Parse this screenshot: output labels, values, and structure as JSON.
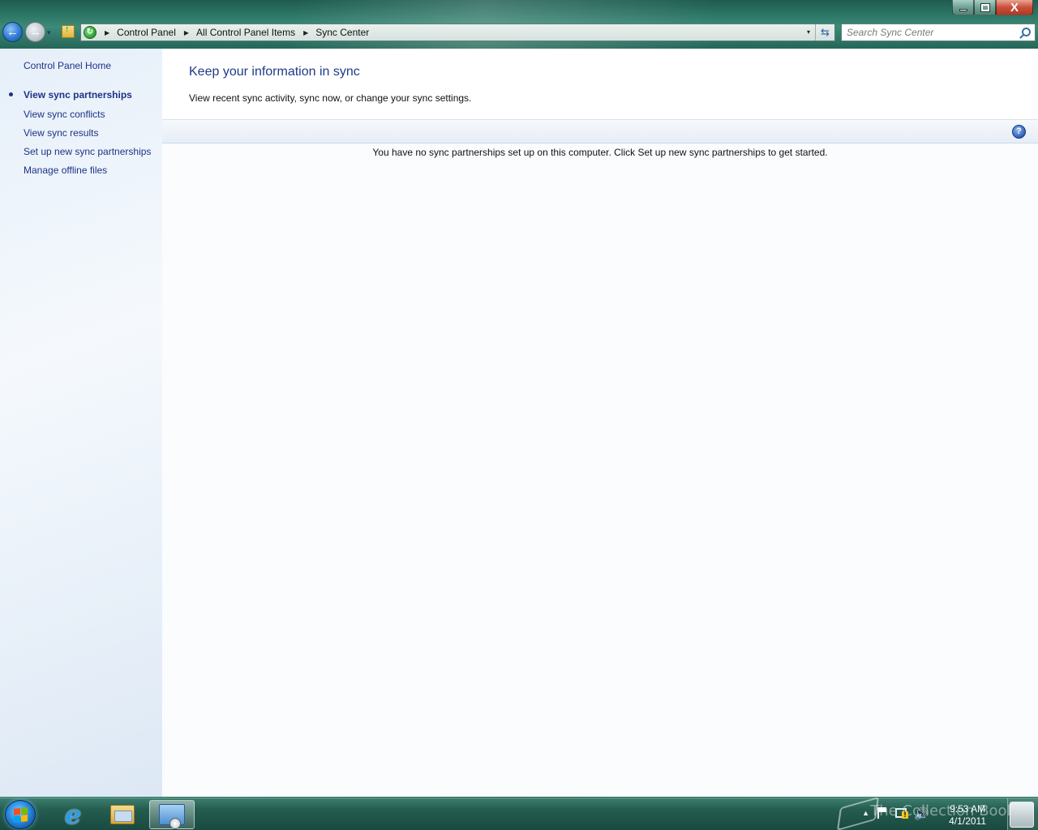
{
  "window": {
    "minimize_label": "—",
    "maximize_label": "",
    "close_label": "X"
  },
  "nav": {
    "back_glyph": "←",
    "forward_glyph": "→",
    "dropdown_glyph": "▾"
  },
  "address": {
    "crumbs": [
      "Control Panel",
      "All Control Panel Items",
      "Sync Center"
    ],
    "separator": "▶",
    "dropdown_glyph": "▾",
    "refresh_glyph": "⇆"
  },
  "search": {
    "placeholder": "Search Sync Center",
    "value": ""
  },
  "sidebar": {
    "home_link": "Control Panel Home",
    "items": [
      {
        "label": "View sync partnerships",
        "active": true
      },
      {
        "label": "View sync conflicts"
      },
      {
        "label": "View sync results"
      },
      {
        "label": "Set up new sync partnerships"
      },
      {
        "label": "Manage offline files"
      }
    ]
  },
  "main": {
    "title": "Keep your information in sync",
    "subtitle": "View recent sync activity, sync now, or change your sync settings.",
    "help_glyph": "?",
    "empty_message": "You have no sync partnerships set up on this computer. Click Set up new sync partnerships to get started."
  },
  "taskbar": {
    "apps": [
      "start-button",
      "internet-explorer",
      "windows-explorer",
      "sync-center"
    ],
    "ie_glyph": "e",
    "tray": {
      "arrow_glyph": "▲",
      "volume_glyph": "🔊",
      "time": "9:53 AM",
      "date": "4/1/2011",
      "watermark": "The Collection Book"
    }
  },
  "colors": {
    "link": "#1e3287",
    "title": "#1e3a8a",
    "window_frame": "#2c7565",
    "left_pane": "#e6eff9"
  }
}
